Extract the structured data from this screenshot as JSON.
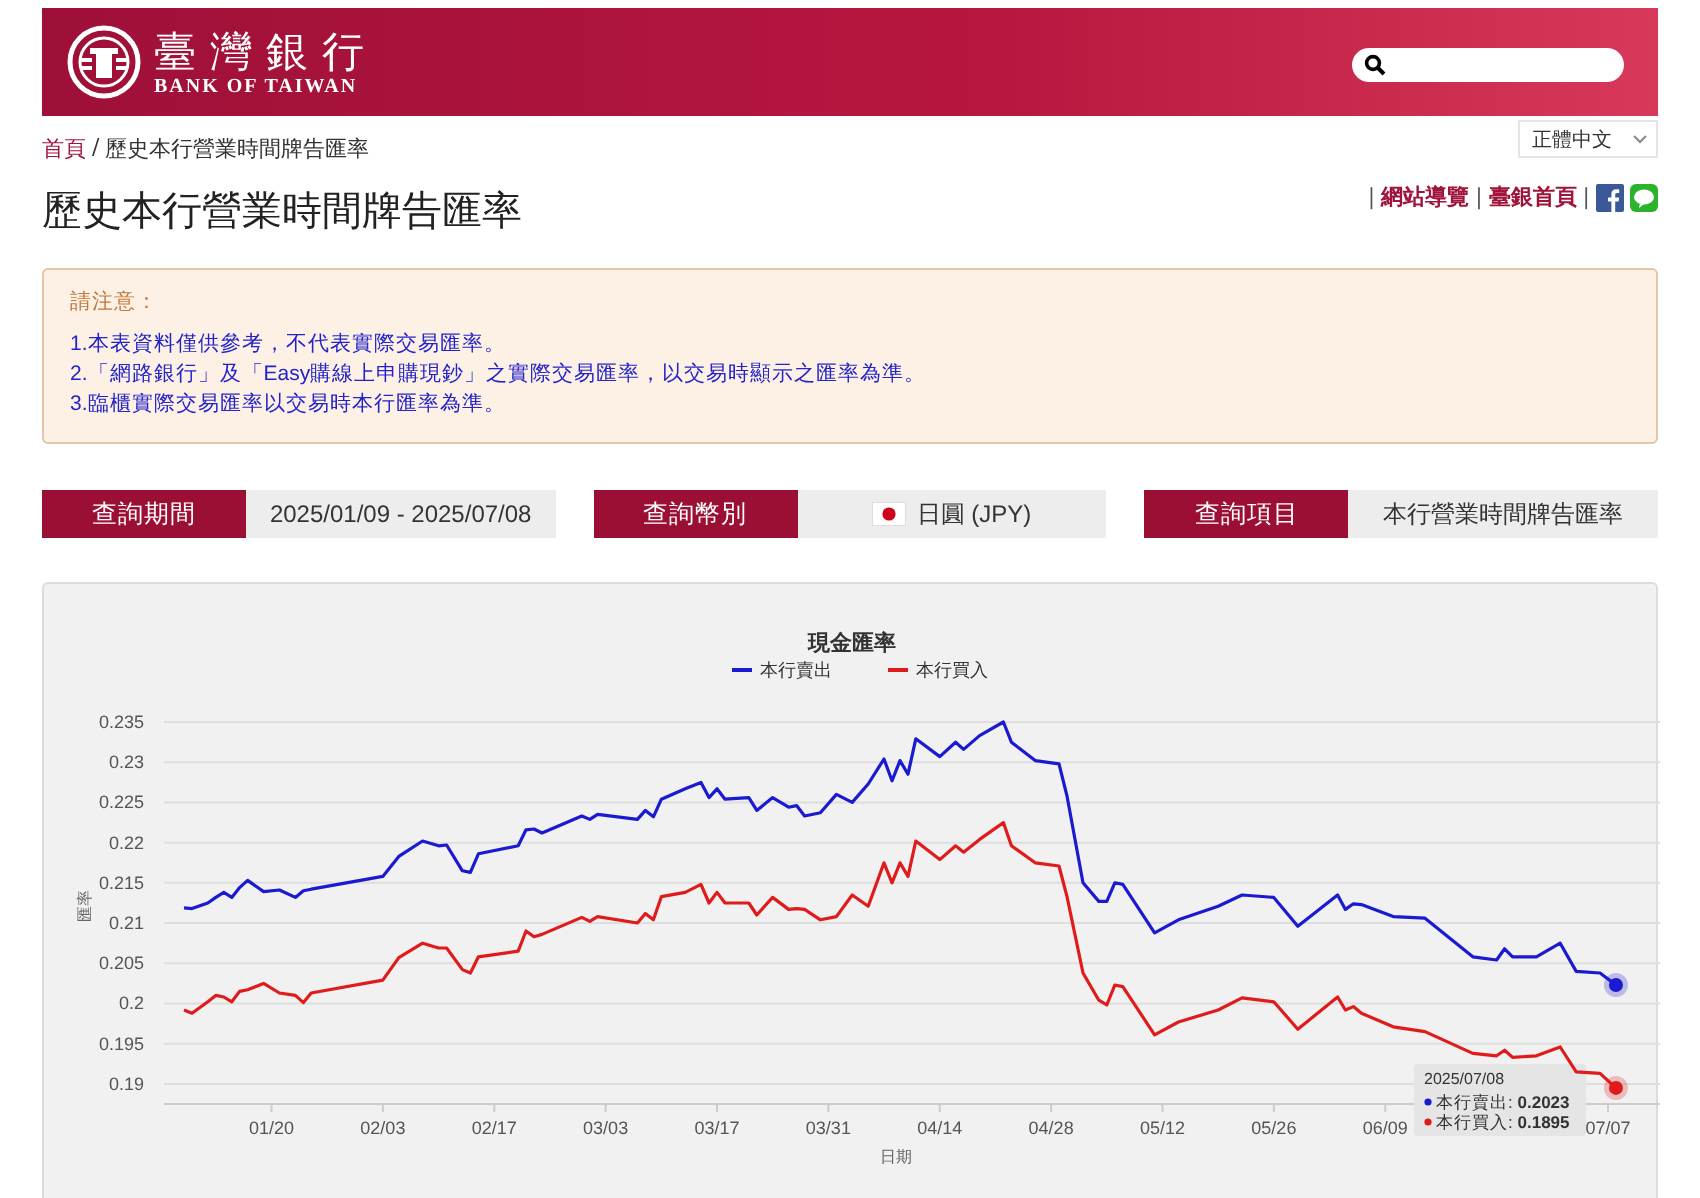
{
  "header": {
    "brand_name": "臺灣銀行",
    "brand_name_en": "BANK OF TAIWAN",
    "language": "正體中文"
  },
  "breadcrumb": {
    "home": "首頁",
    "separator": "/",
    "current": "歷史本行營業時間牌告匯率"
  },
  "page_title": "歷史本行營業時間牌告匯率",
  "top_links": {
    "separator": "|",
    "items": [
      "網站導覽",
      "臺銀首頁"
    ]
  },
  "notice": {
    "heading": "請注意：",
    "lines": [
      "1.本表資料僅供參考，不代表實際交易匯率。",
      "2.「網路銀行」及「Easy購線上申購現鈔」之實際交易匯率，以交易時顯示之匯率為準。",
      "3.臨櫃實際交易匯率以交易時本行匯率為準。"
    ]
  },
  "query": [
    {
      "label": "查詢期間",
      "value": "2025/01/09 - 2025/07/08"
    },
    {
      "label": "查詢幣別",
      "value": "日圓 (JPY)",
      "kind": "currency"
    },
    {
      "label": "查詢項目",
      "value": "本行營業時間牌告匯率"
    }
  ],
  "chart": {
    "chart_data": {
      "type": "line",
      "title": "現金匯率",
      "xlabel": "日期",
      "ylabel": "匯率",
      "categories": [
        null,
        null,
        null,
        null,
        null,
        null,
        null,
        null,
        null,
        null,
        null,
        "01/20",
        null,
        null,
        null,
        null,
        null,
        null,
        null,
        null,
        null,
        null,
        null,
        null,
        null,
        "02/03",
        null,
        null,
        null,
        null,
        null,
        null,
        null,
        null,
        null,
        null,
        null,
        null,
        null,
        "02/17",
        null,
        null,
        null,
        null,
        null,
        null,
        null,
        null,
        null,
        null,
        null,
        null,
        null,
        "03/03",
        null,
        null,
        null,
        null,
        null,
        null,
        null,
        null,
        null,
        null,
        null,
        null,
        null,
        "03/17",
        null,
        null,
        null,
        null,
        null,
        null,
        null,
        null,
        null,
        null,
        null,
        null,
        null,
        "03/31",
        null,
        null,
        null,
        null,
        null,
        null,
        null,
        null,
        null,
        null,
        null,
        null,
        null,
        "04/14",
        null,
        null,
        null,
        null,
        null,
        null,
        null,
        null,
        null,
        null,
        null,
        null,
        null,
        "04/28",
        null,
        null,
        null,
        null,
        null,
        null,
        null,
        null,
        null,
        null,
        null,
        null,
        null,
        "05/12",
        null,
        null,
        null,
        null,
        null,
        null,
        null,
        null,
        null,
        null,
        null,
        null,
        null,
        "05/26",
        null,
        null,
        null,
        null,
        null,
        null,
        null,
        null,
        null,
        null,
        null,
        null,
        null,
        "06/09",
        null,
        null,
        null,
        null,
        null,
        null,
        null,
        null,
        null,
        null,
        null,
        null,
        null,
        null,
        null,
        null,
        null,
        null,
        null,
        null,
        null,
        null,
        null,
        null,
        null,
        null,
        null,
        "07/07",
        null
      ],
      "series": [
        {
          "name": "本行賣出",
          "color": "#1a1ad0",
          "values": [
            0.2119,
            0.2118,
            null,
            0.2125,
            0.2132,
            0.2138,
            0.2132,
            0.2144,
            0.2153,
            null,
            0.2139,
            null,
            0.2141,
            null,
            0.2132,
            0.214,
            0.2142,
            null,
            null,
            null,
            null,
            null,
            null,
            null,
            null,
            0.2158,
            null,
            0.2183,
            null,
            null,
            0.2202,
            null,
            0.2196,
            0.2197,
            null,
            0.2165,
            0.2163,
            0.2186,
            null,
            null,
            null,
            null,
            0.2196,
            0.2216,
            0.2217,
            0.2212,
            null,
            null,
            null,
            null,
            0.2233,
            0.2229,
            0.2235,
            null,
            null,
            null,
            null,
            0.2229,
            0.224,
            0.2232,
            0.2254,
            null,
            null,
            0.2267,
            null,
            0.2275,
            0.2256,
            0.2267,
            0.2254,
            null,
            null,
            0.2256,
            0.224,
            null,
            0.2256,
            null,
            0.2244,
            0.2246,
            0.2233,
            null,
            0.2237,
            null,
            0.226,
            null,
            0.225,
            null,
            0.2273,
            null,
            0.2304,
            0.2277,
            0.2302,
            0.2285,
            0.2329,
            null,
            null,
            0.2307,
            null,
            0.2325,
            0.2316,
            null,
            0.2333,
            null,
            null,
            0.235,
            0.2325,
            null,
            null,
            0.2302,
            null,
            null,
            0.2298,
            0.2258,
            null,
            0.215,
            null,
            0.2127,
            0.2127,
            0.215,
            0.2148,
            null,
            null,
            null,
            0.2088,
            null,
            null,
            0.2104,
            null,
            null,
            null,
            null,
            0.2121,
            null,
            null,
            0.2135,
            null,
            null,
            null,
            0.2132,
            null,
            null,
            0.2096,
            null,
            null,
            null,
            null,
            0.2135,
            0.2117,
            0.2124,
            0.2123,
            null,
            null,
            null,
            0.2108,
            null,
            null,
            null,
            0.2106,
            null,
            null,
            null,
            null,
            null,
            0.2058,
            null,
            null,
            0.2054,
            0.2068,
            0.2058,
            null,
            null,
            0.2058,
            null,
            null,
            0.2075,
            null,
            0.204,
            null,
            null,
            0.2038,
            null,
            0.2023
          ]
        },
        {
          "name": "本行買入",
          "color": "#e01b1b",
          "values": [
            0.1992,
            0.1988,
            null,
            0.2002,
            0.201,
            0.2008,
            0.2002,
            0.2015,
            0.2017,
            null,
            0.2025,
            null,
            0.2013,
            null,
            0.201,
            0.2001,
            0.2013,
            null,
            null,
            null,
            null,
            null,
            null,
            null,
            null,
            0.2029,
            null,
            0.2057,
            null,
            null,
            0.2075,
            null,
            0.2069,
            0.2069,
            null,
            0.2042,
            0.2038,
            0.2058,
            null,
            null,
            null,
            null,
            0.2065,
            0.209,
            0.2083,
            0.2086,
            null,
            null,
            null,
            null,
            0.2107,
            0.2102,
            0.2108,
            null,
            null,
            null,
            null,
            0.21,
            0.2112,
            0.2104,
            0.2133,
            null,
            null,
            0.2138,
            null,
            0.2148,
            0.2125,
            0.2138,
            0.2125,
            null,
            null,
            0.2125,
            0.211,
            null,
            0.2132,
            null,
            0.2117,
            0.2118,
            0.2117,
            null,
            0.2104,
            null,
            0.2108,
            null,
            0.2135,
            null,
            0.2121,
            null,
            0.2175,
            0.215,
            0.2175,
            0.2158,
            0.2202,
            null,
            null,
            0.2179,
            null,
            0.2196,
            0.2188,
            null,
            0.2204,
            null,
            null,
            0.2225,
            0.2196,
            null,
            null,
            0.2175,
            null,
            null,
            0.2171,
            0.2133,
            null,
            0.2038,
            null,
            0.2004,
            0.1998,
            0.2023,
            0.2021,
            null,
            null,
            null,
            0.1961,
            null,
            null,
            0.1977,
            null,
            null,
            null,
            null,
            0.1992,
            null,
            null,
            0.2007,
            null,
            null,
            null,
            0.2002,
            null,
            null,
            0.1968,
            null,
            null,
            null,
            null,
            0.2008,
            0.1992,
            0.1996,
            0.1988,
            null,
            null,
            null,
            0.1971,
            null,
            null,
            null,
            0.1965,
            null,
            null,
            null,
            null,
            null,
            0.1938,
            null,
            null,
            0.1935,
            0.1942,
            0.1933,
            null,
            null,
            0.1935,
            null,
            null,
            0.1946,
            null,
            0.1915,
            null,
            null,
            0.1913,
            null,
            0.1895
          ]
        }
      ],
      "ylim": [
        0.1875,
        0.235
      ],
      "grid": true,
      "legend": "top",
      "yticks": [
        {
          "value": 0.19,
          "label": "0.19"
        },
        {
          "value": 0.195,
          "label": "0.195"
        },
        {
          "value": 0.2,
          "label": "0.2"
        },
        {
          "value": 0.205,
          "label": "0.205"
        },
        {
          "value": 0.21,
          "label": "0.21"
        },
        {
          "value": 0.215,
          "label": "0.215"
        },
        {
          "value": 0.22,
          "label": "0.22"
        },
        {
          "value": 0.225,
          "label": "0.225"
        },
        {
          "value": 0.23,
          "label": "0.23"
        },
        {
          "value": 0.235,
          "label": "0.235"
        }
      ]
    },
    "tooltip": {
      "date": "2025/07/08",
      "rows": [
        {
          "label": "本行賣出:",
          "value": "0.2023"
        },
        {
          "label": "本行買入:",
          "value": "0.1895"
        }
      ]
    }
  }
}
